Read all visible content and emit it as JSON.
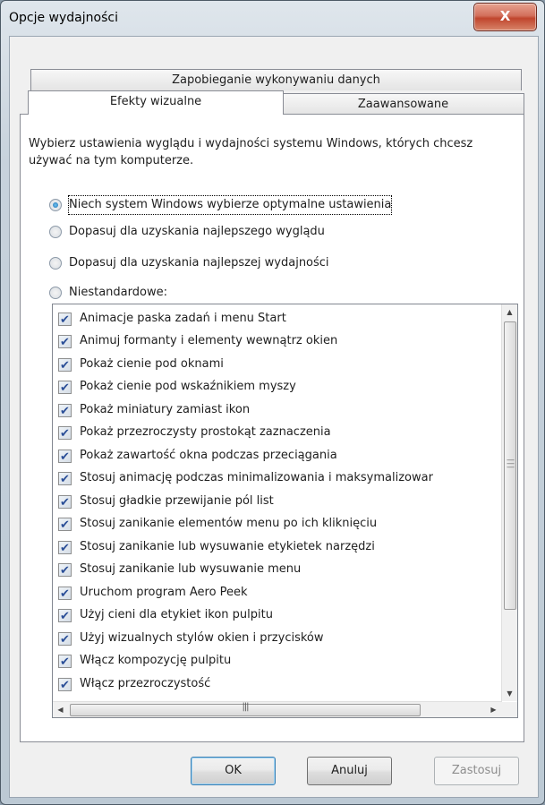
{
  "window": {
    "title": "Opcje wydajności",
    "close_label": "X"
  },
  "tabs": [
    {
      "label": "Zapobieganie wykonywaniu danych"
    },
    {
      "label": "Efekty wizualne"
    },
    {
      "label": "Zaawansowane"
    }
  ],
  "description": "Wybierz ustawienia wyglądu i wydajności systemu Windows, których chcesz używać na tym komputerze.",
  "options": [
    {
      "label": "Niech system Windows wybierze optymalne ustawienia",
      "selected": true
    },
    {
      "label": "Dopasuj dla uzyskania najlepszego wyglądu",
      "selected": false
    },
    {
      "label": "Dopasuj dla uzyskania najlepszej wydajności",
      "selected": false
    },
    {
      "label": "Niestandardowe:",
      "selected": false
    }
  ],
  "effects": [
    {
      "label": "Animacje paska zadań i menu Start",
      "checked": true
    },
    {
      "label": "Animuj formanty i elementy wewnątrz okien",
      "checked": true
    },
    {
      "label": "Pokaż cienie pod oknami",
      "checked": true
    },
    {
      "label": "Pokaż cienie pod wskaźnikiem myszy",
      "checked": true
    },
    {
      "label": "Pokaż miniatury zamiast ikon",
      "checked": true
    },
    {
      "label": "Pokaż przezroczysty prostokąt zaznaczenia",
      "checked": true
    },
    {
      "label": "Pokaż zawartość okna podczas przeciągania",
      "checked": true
    },
    {
      "label": "Stosuj animację podczas minimalizowania i maksymalizowar",
      "checked": true
    },
    {
      "label": "Stosuj gładkie przewijanie pól list",
      "checked": true
    },
    {
      "label": "Stosuj zanikanie elementów menu po ich kliknięciu",
      "checked": true
    },
    {
      "label": "Stosuj zanikanie lub wysuwanie etykietek narzędzi",
      "checked": true
    },
    {
      "label": "Stosuj zanikanie lub wysuwanie menu",
      "checked": true
    },
    {
      "label": "Uruchom program Aero Peek",
      "checked": true
    },
    {
      "label": "Użyj cieni dla etykiet ikon pulpitu",
      "checked": true
    },
    {
      "label": "Użyj wizualnych stylów okien i przycisków",
      "checked": true
    },
    {
      "label": "Włącz kompozycję pulpitu",
      "checked": true
    },
    {
      "label": "Włącz przezroczystość",
      "checked": true
    }
  ],
  "buttons": {
    "ok": "OK",
    "cancel": "Anuluj",
    "apply": "Zastosuj"
  },
  "colors": {
    "close_red": "#c0452d",
    "accent_blue": "#2a4e97"
  }
}
